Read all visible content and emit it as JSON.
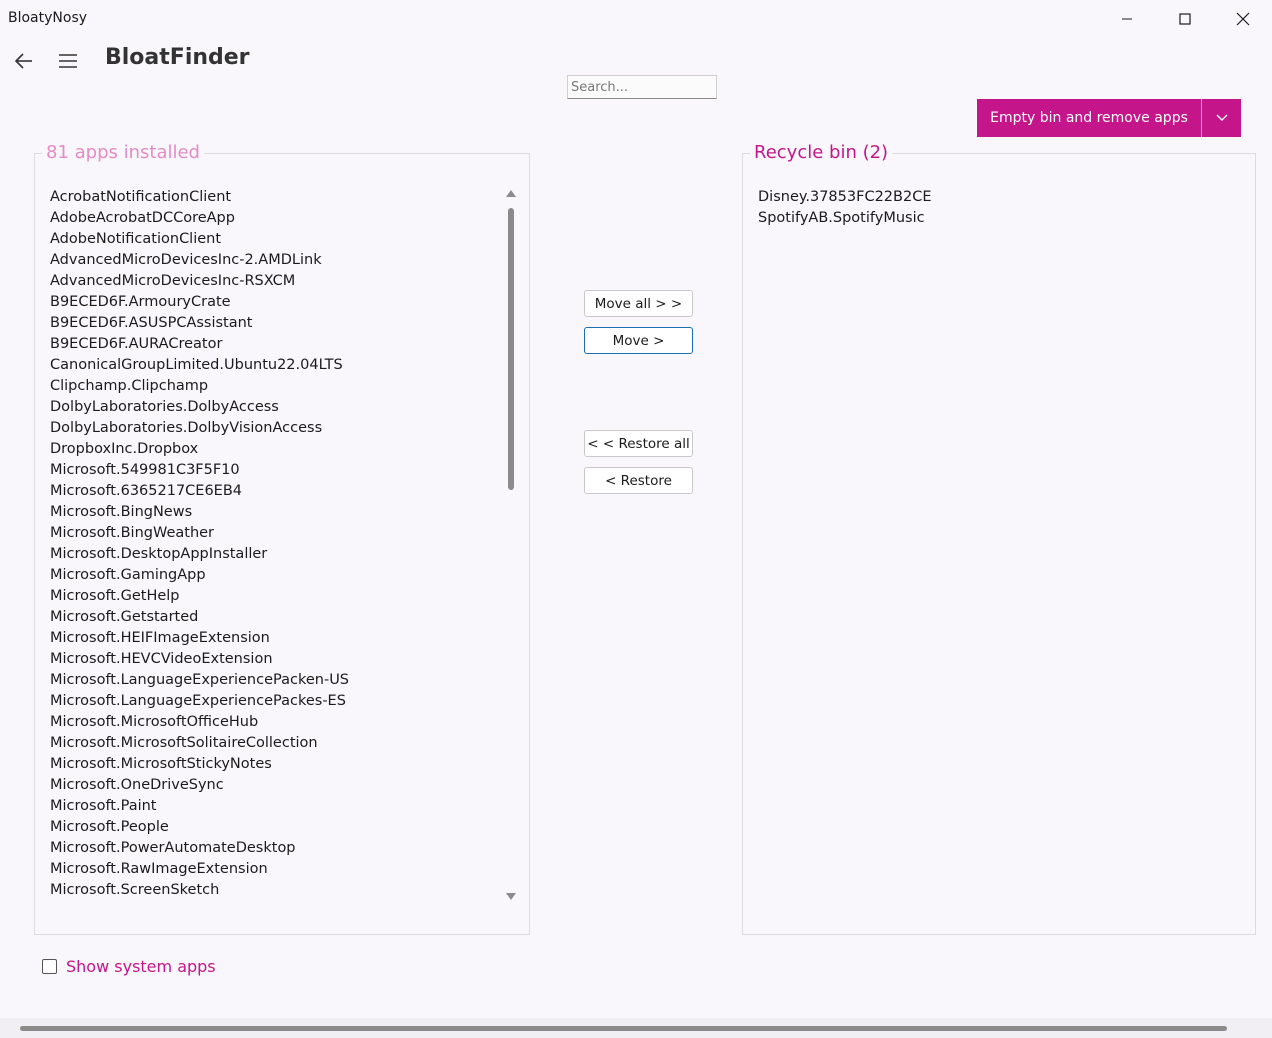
{
  "window": {
    "title": "BloatyNosy"
  },
  "header": {
    "title": "BloatFinder"
  },
  "search": {
    "placeholder": "Search..."
  },
  "actions": {
    "primary_label": "Empty bin and remove apps",
    "accent": "#c4168a"
  },
  "installed": {
    "title": "81 apps installed",
    "items": [
      "AcrobatNotificationClient",
      "AdobeAcrobatDCCoreApp",
      "AdobeNotificationClient",
      "AdvancedMicroDevicesInc-2.AMDLink",
      "AdvancedMicroDevicesInc-RSXCM",
      "B9ECED6F.ArmouryCrate",
      "B9ECED6F.ASUSPCAssistant",
      "B9ECED6F.AURACreator",
      "CanonicalGroupLimited.Ubuntu22.04LTS",
      "Clipchamp.Clipchamp",
      "DolbyLaboratories.DolbyAccess",
      "DolbyLaboratories.DolbyVisionAccess",
      "DropboxInc.Dropbox",
      "Microsoft.549981C3F5F10",
      "Microsoft.6365217CE6EB4",
      "Microsoft.BingNews",
      "Microsoft.BingWeather",
      "Microsoft.DesktopAppInstaller",
      "Microsoft.GamingApp",
      "Microsoft.GetHelp",
      "Microsoft.Getstarted",
      "Microsoft.HEIFImageExtension",
      "Microsoft.HEVCVideoExtension",
      "Microsoft.LanguageExperiencePacken-US",
      "Microsoft.LanguageExperiencePackes-ES",
      "Microsoft.MicrosoftOfficeHub",
      "Microsoft.MicrosoftSolitaireCollection",
      "Microsoft.MicrosoftStickyNotes",
      "Microsoft.OneDriveSync",
      "Microsoft.Paint",
      "Microsoft.People",
      "Microsoft.PowerAutomateDesktop",
      "Microsoft.RawImageExtension",
      "Microsoft.ScreenSketch"
    ]
  },
  "bin": {
    "title": "Recycle bin (2)",
    "items": [
      "Disney.37853FC22B2CE",
      "SpotifyAB.SpotifyMusic"
    ]
  },
  "buttons": {
    "move_all": "Move all > >",
    "move": "Move >",
    "restore_all": "< < Restore all",
    "restore": "< Restore"
  },
  "options": {
    "show_system_apps": "Show system apps"
  }
}
